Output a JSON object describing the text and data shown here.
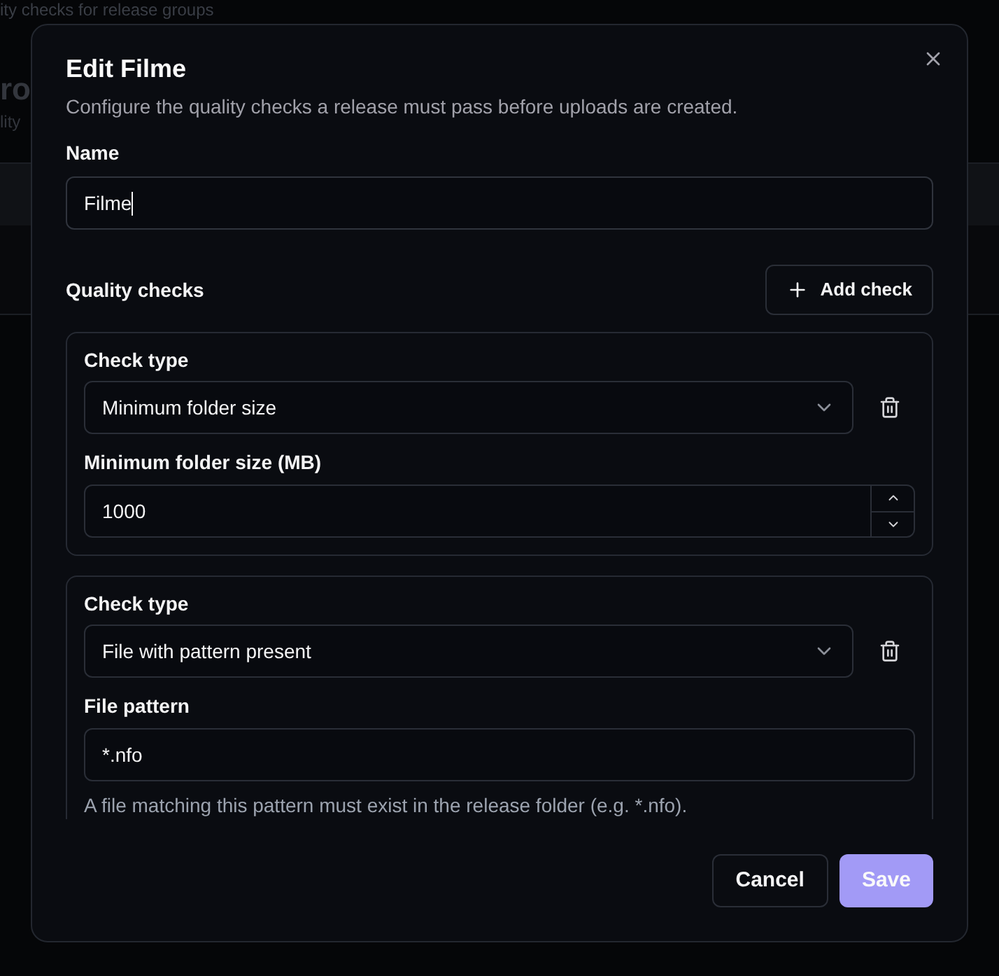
{
  "background": {
    "subtitle": "ity checks for release groups",
    "heading": "ro",
    "caption": "lity"
  },
  "dialog": {
    "title": "Edit Filme",
    "description": "Configure the quality checks a release must pass before uploads are created.",
    "name_field": {
      "label": "Name",
      "value": "Filme",
      "focused": true
    },
    "quality_checks": {
      "title": "Quality checks",
      "add_button": "Add check",
      "checks": [
        {
          "kind": "number",
          "type_label": "Check type",
          "type_value": "Minimum folder size",
          "field_label": "Minimum folder size (MB)",
          "value": "1000"
        },
        {
          "kind": "text",
          "type_label": "Check type",
          "type_value": "File with pattern present",
          "field_label": "File pattern",
          "value": "*.nfo",
          "help": "A file matching this pattern must exist in the release folder (e.g. *.nfo)."
        }
      ]
    },
    "buttons": {
      "cancel": "Cancel",
      "save": "Save"
    }
  }
}
